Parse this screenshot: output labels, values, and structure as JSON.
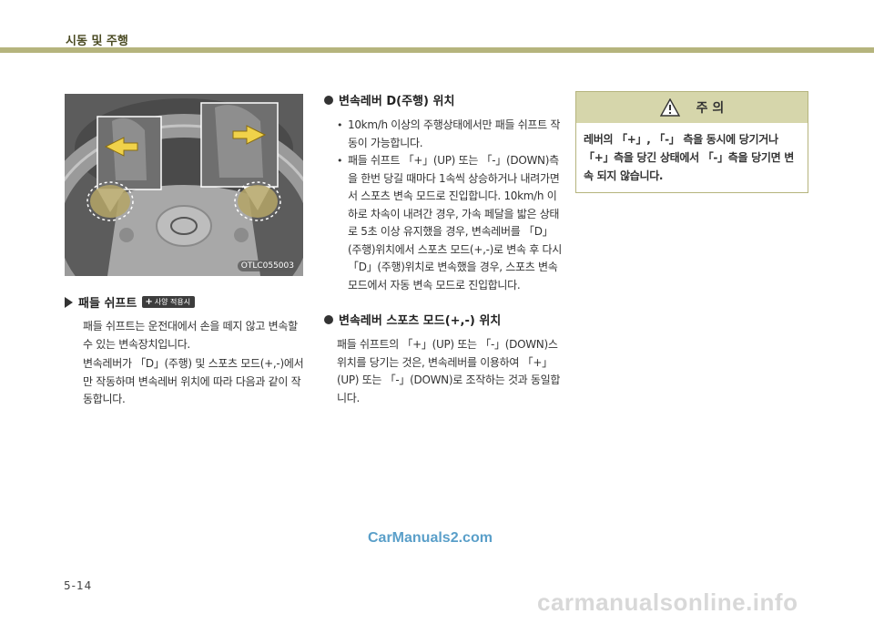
{
  "header": {
    "title": "시동 및 주행"
  },
  "figure": {
    "code": "OTLC055003"
  },
  "left": {
    "title": "패들 쉬프트",
    "badge": "사양 적용시",
    "paragraphs": [
      "패들 쉬프트는 운전대에서 손을 떼지 않고 변속할 수 있는 변속장치입니다.",
      "변속레버가 「D」(주행) 및 스포츠 모드(+,-)에서 만 작동하며 변속레버 위치에 따라 다음과 같이 작동합니다."
    ]
  },
  "middle": {
    "section1_title": "변속레버 D(주행) 위치",
    "bullets": [
      "10km/h 이상의 주행상태에서만 패들 쉬프트 작동이 가능합니다.",
      "패들 쉬프트 「+」(UP) 또는 「-」(DOWN)측을 한번 당길 때마다 1속씩 상승하거나 내려가면서 스포츠 변속 모드로 진입합니다. 10km/h 이하로 차속이 내려간 경우, 가속 페달을 밟은 상태로 5초 이상 유지했을 경우, 변속레버를 「D」(주행)위치에서 스포츠 모드(+,-)로 변속 후 다시 「D」(주행)위치로 변속했을 경우, 스포츠 변속 모드에서 자동 변속 모드로 진입합니다."
    ],
    "section2_title": "변속레버 스포츠 모드(+,-) 위치",
    "section2_text": "패들 쉬프트의 「+」(UP) 또는 「-」(DOWN)스위치를 당기는 것은, 변속레버를 이용하여 「+」(UP) 또는 「-」(DOWN)로 조작하는 것과 동일합니다."
  },
  "caution": {
    "title": "주 의",
    "text": "레버의 「+」, 「-」 측을 동시에 당기거나 「+」측을 당긴 상태에서 「-」측을 당기면 변속 되지 않습니다."
  },
  "watermark": "CarManuals2.com",
  "page_number": "5-14",
  "footer_watermark": "carmanualsonline.info",
  "icons": {
    "section_marker": "triangle-right-icon",
    "badge": "plus-icon",
    "warning": "warning-triangle-icon"
  }
}
